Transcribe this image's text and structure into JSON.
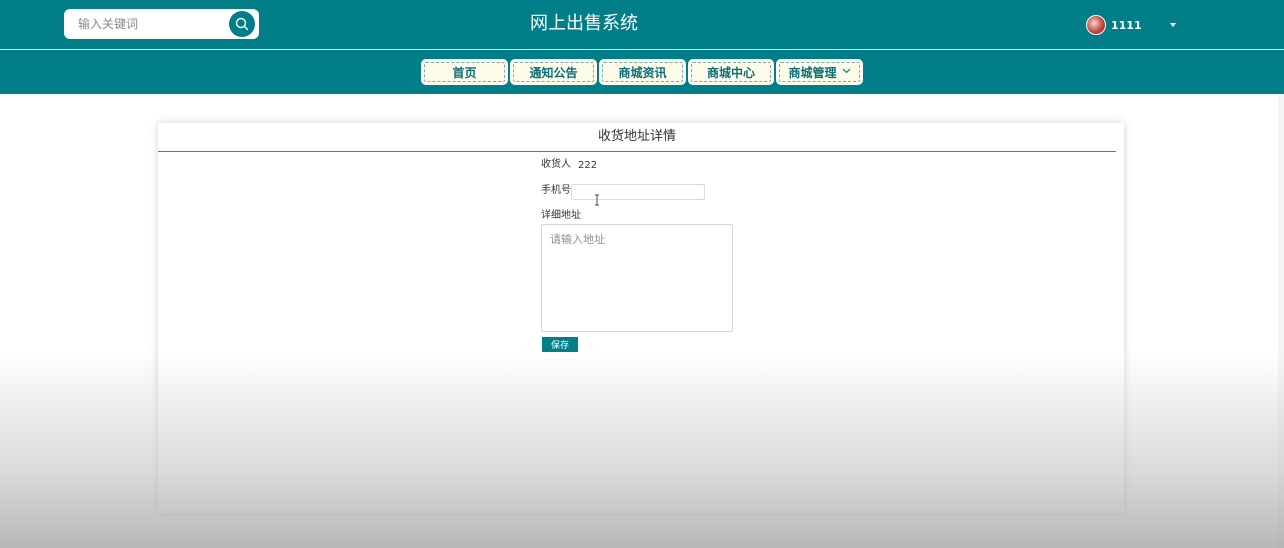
{
  "header": {
    "search_placeholder": "输入关键词",
    "site_title": "网上出售系统",
    "username": "1111"
  },
  "nav": {
    "items": [
      {
        "label": "首页"
      },
      {
        "label": "通知公告"
      },
      {
        "label": "商城资讯"
      },
      {
        "label": "商城中心"
      },
      {
        "label": "商城管理"
      }
    ]
  },
  "form": {
    "title": "收货地址详情",
    "receiver_label": "收货人",
    "receiver_value": "222",
    "phone_label": "手机号",
    "phone_value": "",
    "address_label": "详细地址",
    "address_placeholder": "请输入地址",
    "save_label": "保存"
  },
  "colors": {
    "brand": "#027e89",
    "nav_button_bg": "#fdfbe9"
  },
  "icons": {
    "search": "search-icon",
    "dropdown": "chevron-down-icon",
    "caret": "caret-down-icon",
    "cursor": "text-cursor-icon"
  }
}
